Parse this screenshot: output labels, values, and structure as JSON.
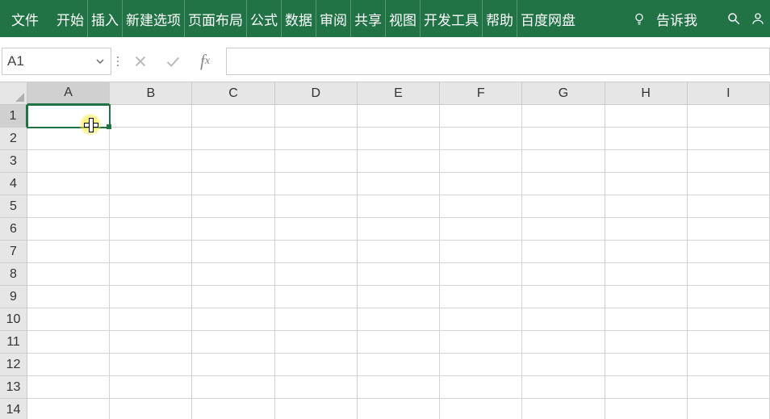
{
  "ribbon": {
    "tabs": [
      "文件",
      "开始",
      "插入",
      "新建选项",
      "页面布局",
      "公式",
      "数据",
      "审阅",
      "共享",
      "视图",
      "开发工具",
      "帮助",
      "百度网盘"
    ],
    "tell_me": "告诉我"
  },
  "formula_bar": {
    "name_box": "A1",
    "formula_value": ""
  },
  "grid": {
    "columns": [
      "A",
      "B",
      "C",
      "D",
      "E",
      "F",
      "G",
      "H",
      "I"
    ],
    "rows": [
      "1",
      "2",
      "3",
      "4",
      "5",
      "6",
      "7",
      "8",
      "9",
      "10",
      "11",
      "12",
      "13",
      "14"
    ],
    "active_cell": "A1"
  }
}
